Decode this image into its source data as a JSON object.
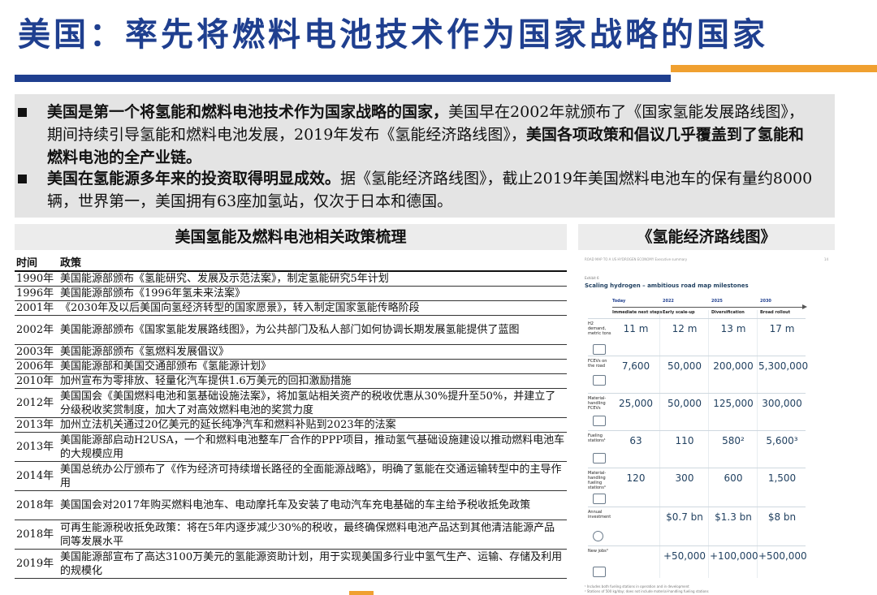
{
  "title": "美国：率先将燃料电池技术作为国家战略的国家",
  "summary": {
    "b1_bold1": "美国是第一个将氢能和燃料电池技术作为国家战略的国家，",
    "b1_text1": "美国早在2002年就颁布了《国家氢能发展路线图》，期间持续引导氢能和燃料电池发展，2019年发布《氢能经济路线图》，",
    "b1_bold2": "美国各项政策和倡议几乎覆盖到了氢能和燃料电池的全产业链。",
    "b2_bold1": "美国在氢能源多年来的投资取得明显成效。",
    "b2_text1": "据《氢能经济路线图》，截止2019年美国燃料电池车的保有量约8000辆，世界第一，美国拥有63座加氢站，仅次于日本和德国。"
  },
  "left_section": {
    "heading": "美国氢能及燃料电池相关政策梳理",
    "col_time": "时间",
    "col_policy": "政策",
    "rows": [
      {
        "year": "1990年",
        "text": "美国能源部颁布《氢能研究、发展及示范法案》，制定氢能研究5年计划"
      },
      {
        "year": "1996年",
        "text": "美国能源部颁布《1996年氢未来法案》"
      },
      {
        "year": "2001年",
        "text": "《2030年及以后美国向氢经济转型的国家愿景》，转入制定国家氢能传略阶段"
      },
      {
        "year": "2002年",
        "text": "美国能源部颁布《国家氢能发展路线图》，为公共部门及私人部门如何协调长期发展氢能提供了蓝图"
      },
      {
        "year": "2003年",
        "text": "美国能源部颁布《氢燃料发展倡议》"
      },
      {
        "year": "2006年",
        "text": "美国能源部和美国交通部颁布《氢能源计划》"
      },
      {
        "year": "2010年",
        "text": "加州宣布为零排放、轻量化汽车提供1.6万美元的回扣激励措施"
      },
      {
        "year": "2012年",
        "text": "美国国会《美国燃料电池和氢基础设施法案》，将加氢站相关资产的税收优惠从30%提升至50%，并建立了分级税收奖赏制度，加大了对高效燃料电池的奖赏力度"
      },
      {
        "year": "2013年",
        "text": "加州立法机关通过20亿美元的延长纯净汽车和燃料补贴到2023年的法案"
      },
      {
        "year": "2013年",
        "text": "美国能源部启动H2USA，一个和燃料电池整车厂合作的PPP项目，推动氢气基础设施建设以推动燃料电池车的大规模应用"
      },
      {
        "year": "2014年",
        "text": "美国总统办公厅颁布了《作为经济可持续增长路径的全面能源战略》，明确了氢能在交通运输转型中的主导作用"
      },
      {
        "year": "2018年",
        "text": "美国国会对2017年购买燃料电池车、电动摩托车及安装了电动汽车充电基础的车主给予税收抵免政策"
      },
      {
        "year": "2018年",
        "text": "可再生能源税收抵免政策：将在5年内逐步减少30%的税收，最终确保燃料电池产品达到其他清洁能源产品同等发展水平"
      },
      {
        "year": "2019年",
        "text": "美国能源部宣布了高达3100万美元的氢能源资助计划，用于实现美国多行业中氢气生产、运输、存储及利用的规模化"
      }
    ]
  },
  "right_section": {
    "heading": "《氢能经济路线图》",
    "chart": {
      "doc_header": "ROAD MAP TO A US HYDROGEN ECONOMY   Executive summary",
      "page_no": "14",
      "exhibit": "Exhibit 6",
      "title": "Scaling hydrogen – ambitious road map milestones",
      "periods": [
        {
          "year": "Today",
          "phase": "Immediate next steps"
        },
        {
          "year": "2022",
          "phase": "Early scale-up"
        },
        {
          "year": "2025",
          "phase": "Diversification"
        },
        {
          "year": "2030",
          "phase": "Broad rollout"
        }
      ],
      "rows": [
        {
          "label": "H2 demand, metric tons",
          "icon": "hydrogen-icon",
          "values": [
            "11 m",
            "12 m",
            "13 m",
            "17 m"
          ]
        },
        {
          "label": "FCEVs on the road",
          "icon": "car-icon",
          "values": [
            "7,600",
            "50,000",
            "200,000",
            "5,300,000"
          ]
        },
        {
          "label": "Material-handling FCEVs",
          "icon": "forklift-icon",
          "values": [
            "25,000",
            "50,000",
            "125,000",
            "300,000"
          ]
        },
        {
          "label": "Fueling stations¹",
          "icon": "fuel-pump-icon",
          "values": [
            "63",
            "110",
            "580²",
            "5,600³"
          ]
        },
        {
          "label": "Material-handling fueling stations⁴",
          "icon": "fuel-pump-icon",
          "values": [
            "120",
            "300",
            "600",
            "1,500"
          ]
        },
        {
          "label": "Annual investment",
          "icon": "dollar-icon",
          "values": [
            "",
            "$0.7 bn",
            "$1.3 bn",
            "$8 bn"
          ]
        },
        {
          "label": "New jobs⁴",
          "icon": "worker-icon",
          "values": [
            "",
            "+50,000",
            "+100,000",
            "+500,000"
          ]
        }
      ],
      "footnotes": [
        "¹ Includes both fueling stations in operation and in development",
        "² Stations of 500 kg/day; does not include material-handling fueling stations"
      ]
    }
  }
}
